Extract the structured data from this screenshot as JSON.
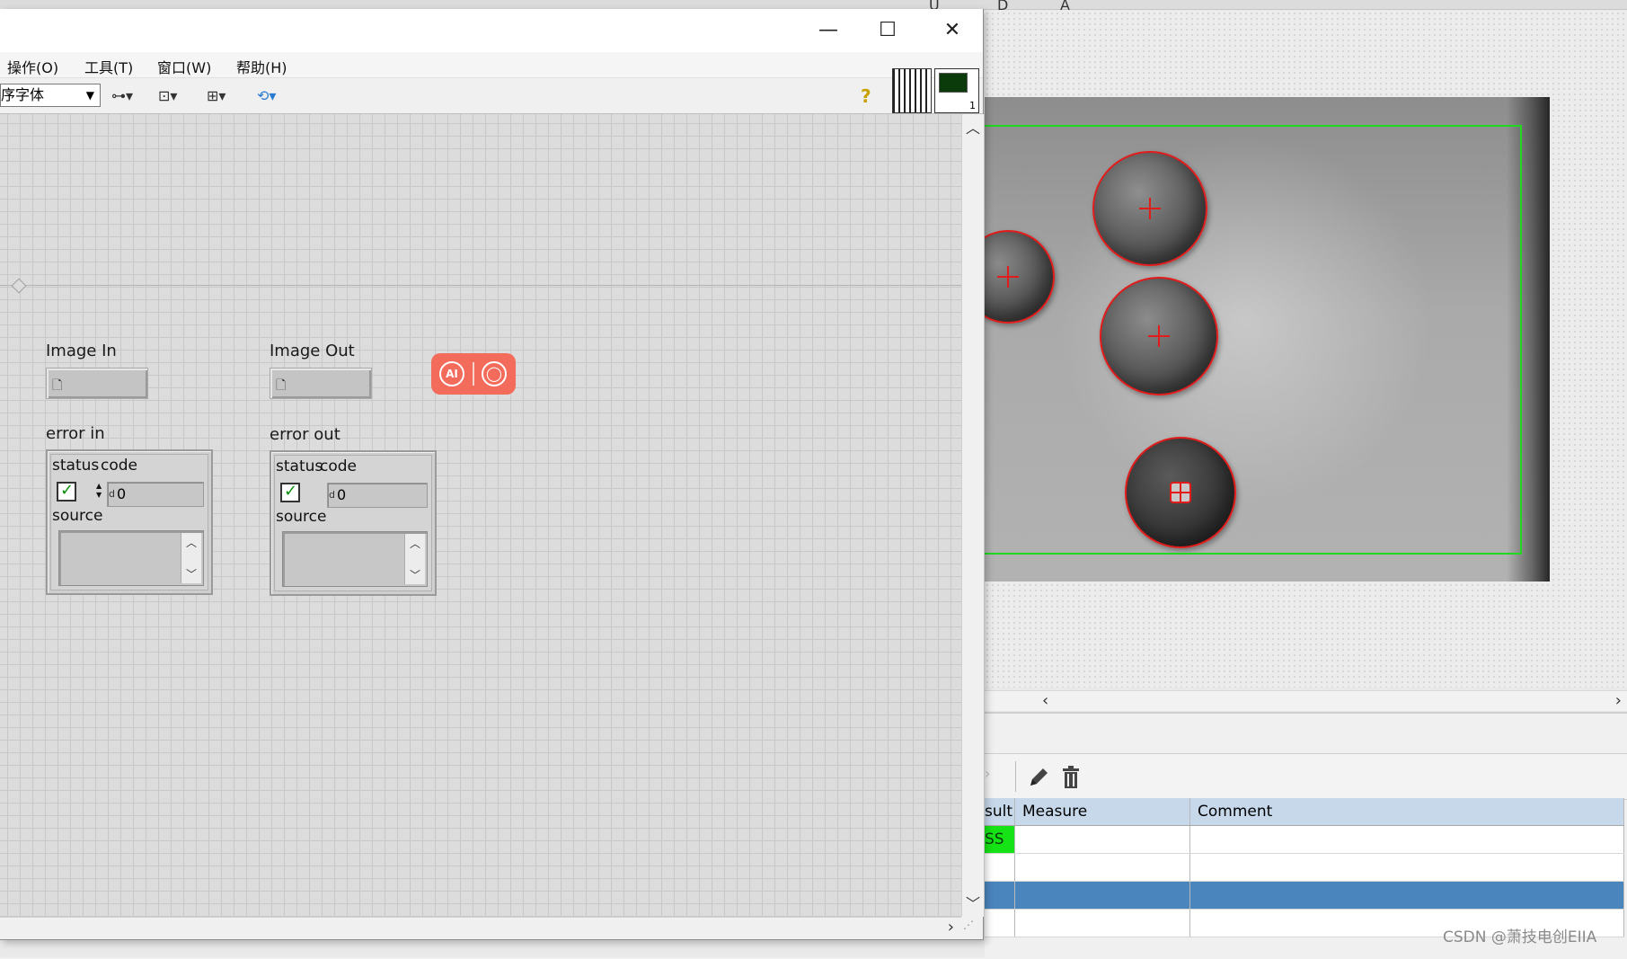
{
  "background_app": {
    "top_strip_letters": [
      "U",
      "D",
      "A"
    ],
    "results_table": {
      "columns": [
        "sult",
        "Measure",
        "Comment"
      ],
      "rows": [
        {
          "result": "SS",
          "measure": "",
          "comment": "",
          "status": "pass"
        },
        {
          "result": "",
          "measure": "",
          "comment": ""
        },
        {
          "result": "",
          "measure": "",
          "comment": "",
          "selected": true
        },
        {
          "result": "",
          "measure": "",
          "comment": ""
        }
      ]
    },
    "toolbar_icons": [
      "play-arrow-icon",
      "pencil-icon",
      "trash-icon"
    ],
    "colors": {
      "roi": "#1fd81f",
      "detected_circle": "#e21b1b",
      "pass": "#16e316",
      "selected_row": "#4a86bd"
    }
  },
  "window": {
    "menu": [
      "操作(O)",
      "工具(T)",
      "窗口(W)",
      "帮助(H)"
    ],
    "font_selector": "序字体",
    "controls": {
      "image_in_label": "Image In",
      "image_out_label": "Image Out",
      "error_in": {
        "label": "error in",
        "status_label": "status",
        "code_label": "code",
        "code_value": "0",
        "source_label": "source",
        "radix": "d"
      },
      "error_out": {
        "label": "error out",
        "status_label": "status",
        "code_label": "code",
        "code_value": "0",
        "source_label": "source",
        "radix": "d"
      }
    },
    "connector_pane_index": "1",
    "ai_widget": {
      "left_label": "AI"
    }
  },
  "watermark": "CSDN @萧技电创EIIA"
}
